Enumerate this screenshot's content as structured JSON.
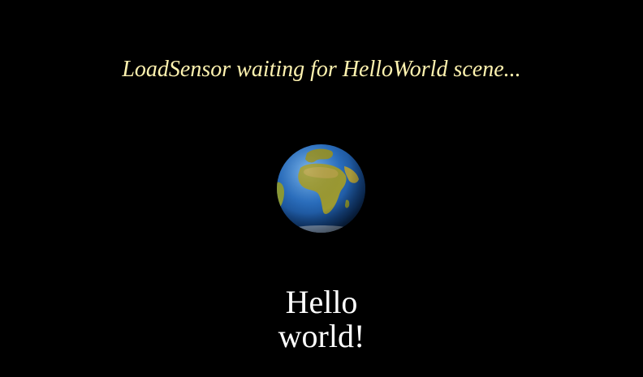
{
  "scene": {
    "status_text": "LoadSensor waiting for HelloWorld scene...",
    "hello_line1": "Hello",
    "hello_line2": "world!",
    "globe_icon": "earth-globe-icon"
  },
  "colors": {
    "background": "#000000",
    "status_text": "#FFF3B0",
    "hello_text": "#FFFFFF",
    "ocean": "#1F63B4",
    "land": "#9C9A32"
  }
}
